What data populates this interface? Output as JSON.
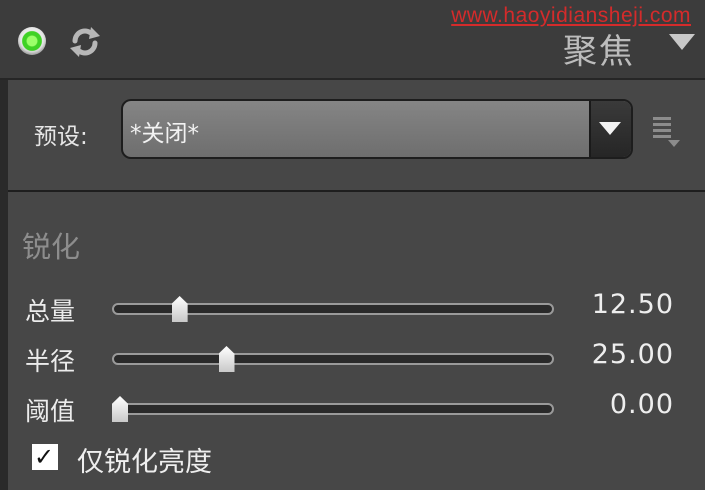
{
  "watermark": "www.haoyidiansheji.com",
  "panel": {
    "title": "聚焦",
    "title_icon": "chevron-down-icon",
    "enable_icon": "enable-toggle-dot",
    "reset_icon": "reset-icon"
  },
  "preset": {
    "label": "预设:",
    "value": "*关闭*",
    "menu_icon": "preset-menu-icon"
  },
  "sharpen": {
    "title": "锐化",
    "sliders": [
      {
        "label": "总量",
        "value": "12.50",
        "fraction": 0.14
      },
      {
        "label": "半径",
        "value": "25.00",
        "fraction": 0.25
      },
      {
        "label": "阈值",
        "value": "0.00",
        "fraction": 0.0
      }
    ],
    "checkbox": {
      "checked": true,
      "label": "仅锐化亮度"
    }
  },
  "colors": {
    "accent_green": "#3fd225",
    "watermark_red": "#d42b2b"
  }
}
